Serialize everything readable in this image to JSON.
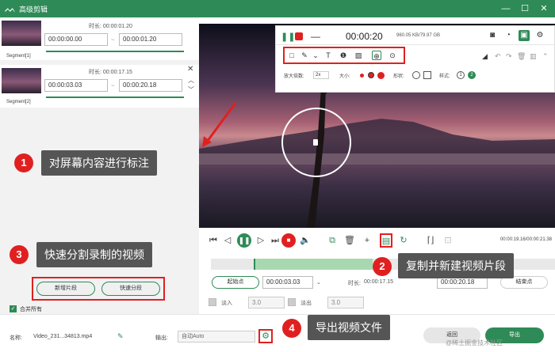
{
  "window": {
    "title": "高级剪辑"
  },
  "segments": [
    {
      "label": "Segment[1]",
      "duration_label": "时长: 00:00:01.20",
      "start": "00:00:00.00",
      "end": "00:00:01.20"
    },
    {
      "label": "Segment[2]",
      "duration_label": "时长: 00:00:17.15",
      "start": "00:00:03.03",
      "end": "00:00:20.18"
    }
  ],
  "recorder": {
    "time": "00:00:20",
    "size": "960.05 KB/79.97 GB",
    "zoom_label": "放大倍数:",
    "zoom_value": "2x",
    "size_label": "大小:",
    "shape_label": "形状:",
    "style_label": "样式:",
    "style_options": [
      "1",
      "2"
    ]
  },
  "controls": {
    "time": "00:00:19.16/00:00:21.38"
  },
  "trim": {
    "start_btn": "起始点",
    "start_time": "00:00:03.03",
    "duration_label": "时长:",
    "duration_value": "00:00:17.15",
    "end_time": "00:00:20.18",
    "end_btn": "结束点",
    "fade_in_label": "淡入",
    "fade_in_value": "3.0",
    "fade_out_label": "淡出",
    "fade_out_value": "3.0"
  },
  "split": {
    "new_segment": "新增片段",
    "quick_split": "快速分段",
    "merge_all": "合并所有"
  },
  "footer": {
    "name_label": "名称:",
    "name_value": "Video_231...34813.mp4",
    "output_label": "输出:",
    "output_value": "自动Auto",
    "cancel": "返回",
    "export": "导出"
  },
  "callouts": [
    {
      "n": "1",
      "text": "对屏幕内容进行标注"
    },
    {
      "n": "2",
      "text": "复制并新建视频片段"
    },
    {
      "n": "3",
      "text": "快速分割录制的视频"
    },
    {
      "n": "4",
      "text": "导出视频文件"
    }
  ],
  "watermark": "@稀土掘金技术社区",
  "colors": {
    "accent": "#2e8b57",
    "highlight": "#e02020",
    "callout_bg": "#555555"
  }
}
